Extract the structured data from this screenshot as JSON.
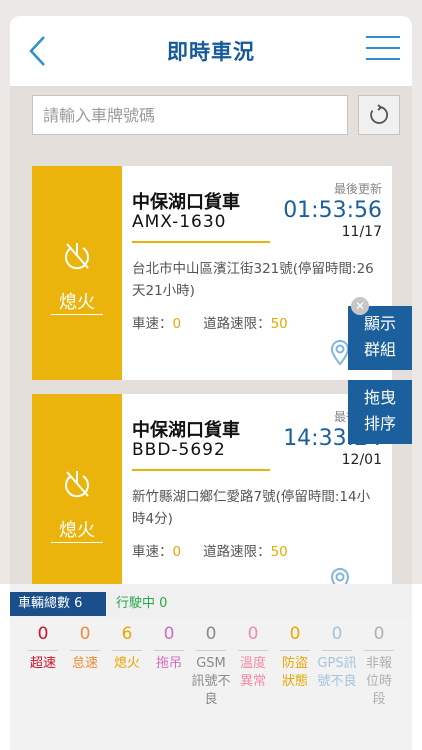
{
  "header": {
    "title": "即時車況"
  },
  "search": {
    "placeholder": "請輸入車牌號碼"
  },
  "vehicles": [
    {
      "status": "熄火",
      "name": "中保湖口貨車",
      "plate": "AMX-1630",
      "update_label": "最後更新",
      "time": "01:53:56",
      "date": "11/17",
      "address": "台北市中山區濱江街321號(停留時間:26天21小時)",
      "speed_label": "車速：",
      "speed": "0",
      "limit_label": "道路速限：",
      "limit": "50"
    },
    {
      "status": "熄火",
      "name": "中保湖口貨車",
      "plate": "BBD-5692",
      "update_label": "最後更新",
      "time": "14:33:24",
      "date": "12/01",
      "address": "新竹縣湖口鄉仁愛路7號(停留時間:14小時4分)",
      "speed_label": "車速：",
      "speed": "0",
      "limit_label": "道路速限：",
      "limit": "50"
    }
  ],
  "float_buttons": {
    "group": "顯示群組",
    "sort": "拖曳排序"
  },
  "bottom": {
    "total_label": "車輛總數",
    "total_count": "6",
    "moving_label": "行駛中",
    "moving_count": "0",
    "stats": [
      {
        "count": "0",
        "label": "超速",
        "color": "#d0112b"
      },
      {
        "count": "0",
        "label": "怠速",
        "color": "#f08c32"
      },
      {
        "count": "6",
        "label": "熄火",
        "color": "#e8a800"
      },
      {
        "count": "0",
        "label": "拖吊",
        "color": "#d36cc0"
      },
      {
        "count": "0",
        "label": "GSM訊號不良",
        "color": "#8a8a8a"
      },
      {
        "count": "0",
        "label": "溫度異常",
        "color": "#f48aa6"
      },
      {
        "count": "0",
        "label": "防盜狀態",
        "color": "#e8a800"
      },
      {
        "count": "0",
        "label": "GPS訊號不良",
        "color": "#a5c3dc"
      },
      {
        "count": "0",
        "label": "非報位時段",
        "color": "#b0b0b0"
      }
    ]
  },
  "icons": {
    "back": "chevron-left-icon",
    "menu": "hamburger-menu-icon",
    "refresh": "refresh-icon",
    "status": "power-off-icon",
    "location": "map-pin-icon",
    "close": "close-icon"
  }
}
